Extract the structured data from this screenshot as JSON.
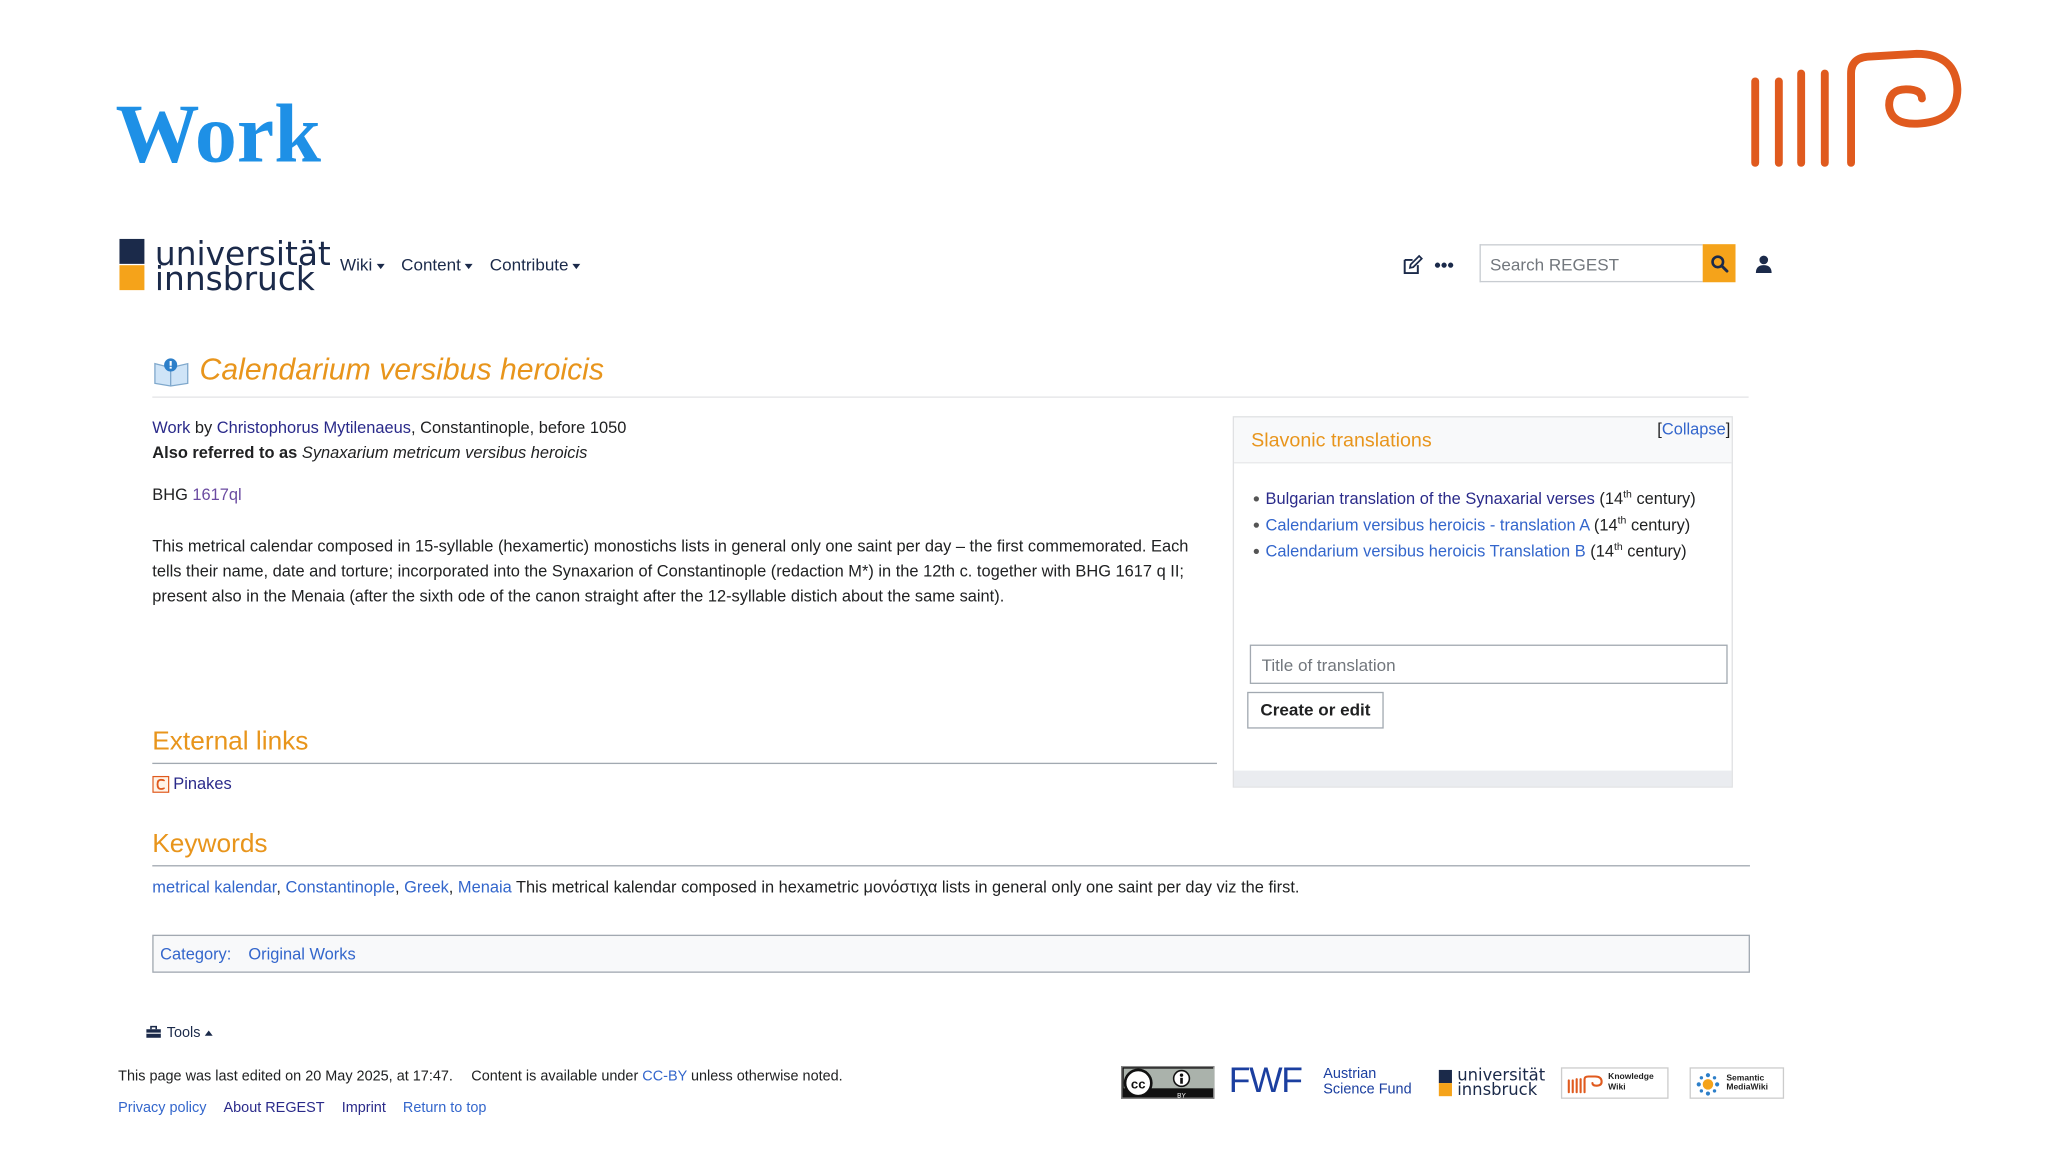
{
  "slide": {
    "title": "Work"
  },
  "header": {
    "uni_line1": "universität",
    "uni_line2": "innsbruck",
    "nav": [
      {
        "label": "Wiki"
      },
      {
        "label": "Content"
      },
      {
        "label": "Contribute"
      }
    ],
    "search_placeholder": "Search REGEST"
  },
  "page": {
    "title": "Calendarium versibus heroicis",
    "work_label": "Work",
    "by": " by ",
    "author": "Christophorus Mytilenaeus",
    "place_date": ", Constantinople, before 1050",
    "aka_label": "Also referred to as",
    "aka_value": "Synaxarium metricum versibus heroicis",
    "bhg_label": "BHG",
    "bhg_value": "1617ql",
    "description": "This metrical calendar composed in 15-syllable (hexamertic) monostichs lists in general only one saint per day – the first commemorated. Each tells their name, date and torture; incorporated into the Synaxarion of Constantinople (redaction M*) in the 12th c. together with BHG 1617 q II; present also in the Menaia (after the sixth ode of the canon straight after the 12-syllable distich about the same saint)."
  },
  "translations": {
    "title": "Slavonic translations",
    "collapse": "Collapse",
    "items": [
      {
        "label": "Bulgarian translation of the Synaxarial verses",
        "pre": " (14",
        "sup": "th",
        "post": " century)"
      },
      {
        "label": "Calendarium versibus heroicis - translation A",
        "pre": " (14",
        "sup": "th",
        "post": " century)"
      },
      {
        "label": "Calendarium versibus heroicis Translation B",
        "pre": " (14",
        "sup": "th",
        "post": " century)"
      }
    ],
    "input_placeholder": "Title of translation",
    "button": "Create or edit"
  },
  "external_links": {
    "heading": "External links",
    "items": [
      {
        "label": "Pinakes"
      }
    ]
  },
  "keywords": {
    "heading": "Keywords",
    "links": [
      "metrical kalendar",
      "Constantinople",
      "Greek",
      "Menaia"
    ],
    "text": " This metrical kalendar composed in hexametric μονόστιχα lists in general only one saint per day viz the first."
  },
  "category": {
    "label": "Category:",
    "value": "Original Works"
  },
  "footer": {
    "tools": "Tools",
    "edited": "This page was last edited on 20 May 2025, at 17:47.",
    "license_pre": "Content is available under ",
    "license_link": "CC-BY",
    "license_post": " unless otherwise noted.",
    "links": [
      "Privacy policy",
      "About REGEST",
      "Imprint",
      "Return to top"
    ],
    "badges": {
      "fwf_short": "FWF",
      "fwf_line1": "Austrian",
      "fwf_line2": "Science Fund",
      "uni_line1": "universität",
      "uni_line2": "innsbruck",
      "kw_line1": "Knowledge",
      "kw_line2": "Wiki",
      "smw_line1": "Semantic",
      "smw_line2": "MediaWiki"
    }
  },
  "colors": {
    "accent": "#e8951c",
    "slide_title": "#1e90e6",
    "brand": "#e05a1e",
    "link": "#3366cc",
    "search_button": "#f5a31a",
    "uni_navy": "#1b2a4a"
  }
}
